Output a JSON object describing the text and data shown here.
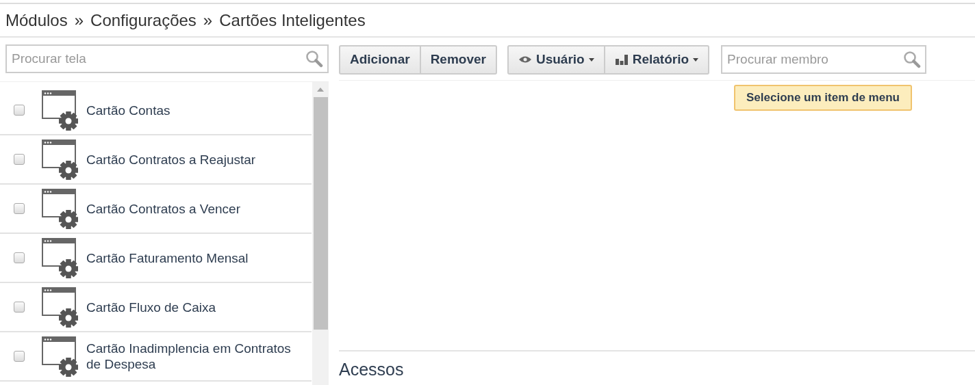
{
  "breadcrumb": {
    "items": [
      "Módulos",
      "Configurações",
      "Cartões Inteligentes"
    ],
    "separator": "»"
  },
  "screen_search": {
    "placeholder": "Procurar tela"
  },
  "screens": [
    {
      "label": "Cartão Contas",
      "checked": false
    },
    {
      "label": "Cartão Contratos a Reajustar",
      "checked": false
    },
    {
      "label": "Cartão Contratos a Vencer",
      "checked": false
    },
    {
      "label": "Cartão Faturamento Mensal",
      "checked": false
    },
    {
      "label": "Cartão Fluxo de Caixa",
      "checked": false
    },
    {
      "label": "Cartão Inadimplencia em Contratos de Despesa",
      "checked": false
    }
  ],
  "toolbar": {
    "groups": [
      [
        {
          "label": "Adicionar",
          "kind": "plain"
        },
        {
          "label": "Remover",
          "kind": "plain"
        }
      ],
      [
        {
          "label": "Usuário",
          "kind": "eye-dropdown"
        },
        {
          "label": "Relatório",
          "kind": "chart-dropdown"
        }
      ]
    ]
  },
  "member_search": {
    "placeholder": "Procurar membro"
  },
  "notice": "Selecione um item de menu",
  "access_section": {
    "title": "Acessos"
  }
}
